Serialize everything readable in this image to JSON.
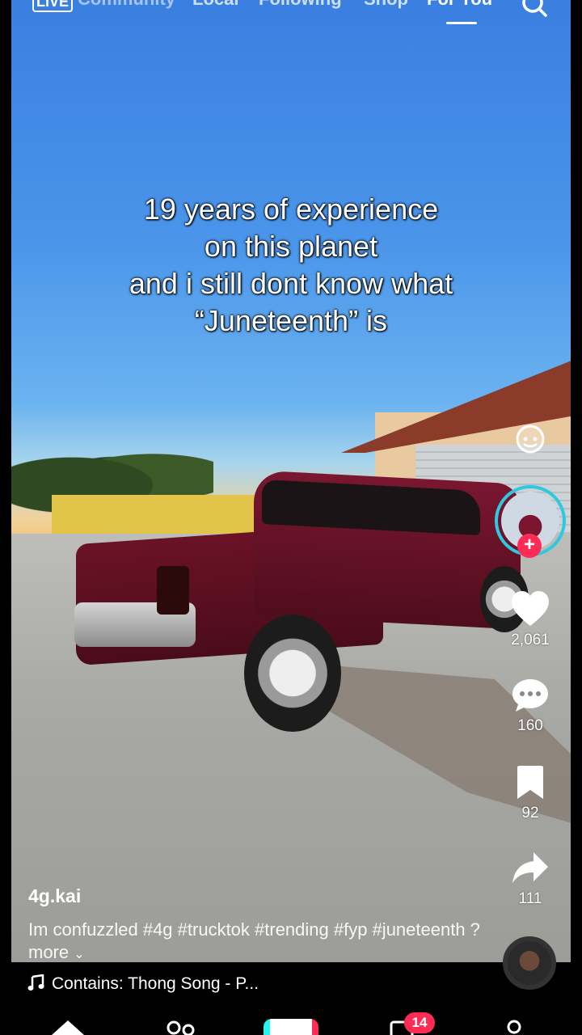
{
  "top_nav": {
    "live": "LIVE",
    "tabs": [
      "Community",
      "Local",
      "Following",
      "Shop",
      "For You"
    ],
    "active_tab": "For You"
  },
  "video": {
    "caption_lines": [
      "19 years of experience",
      "on this planet",
      "and i still dont know what",
      "“Juneteenth” is"
    ]
  },
  "actions": {
    "likes": "2,061",
    "comments": "160",
    "saves": "92",
    "shares": "111"
  },
  "post": {
    "username": "4g.kai",
    "description": "Im confuzzled #4g #trucktok #trending #fyp #juneteenth ? more",
    "sound": "Contains: Thong Song - P..."
  },
  "bottom_nav": {
    "inbox_badge": "14"
  },
  "colors": {
    "accent": "#fe2c55",
    "ring": "#2cc9e0"
  }
}
